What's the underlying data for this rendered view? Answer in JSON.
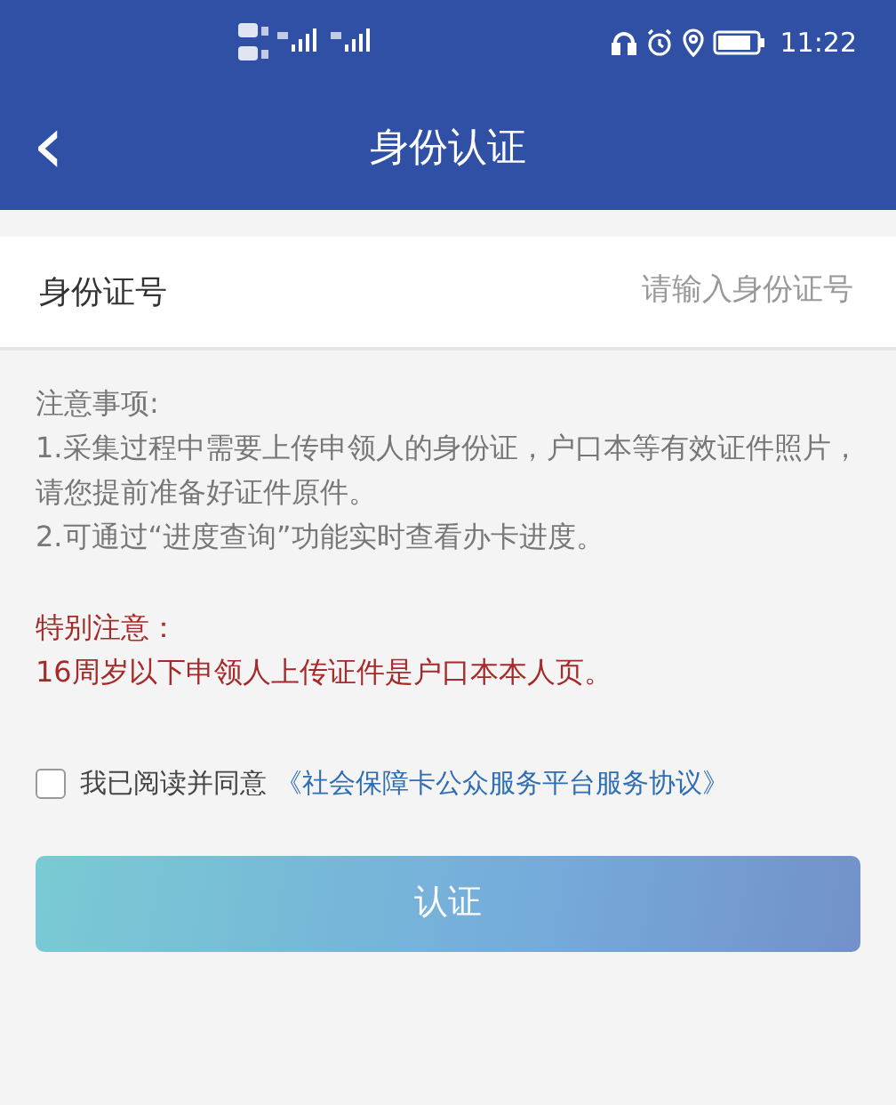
{
  "status_bar": {
    "time": "11:22"
  },
  "header": {
    "back": "‹",
    "title": "身份认证"
  },
  "id_field": {
    "label": "身份证号",
    "placeholder": "请输入身份证号"
  },
  "notes": {
    "heading": "注意事项:",
    "items": [
      "1.采集过程中需要上传申领人的身份证，户口本等有效证件照片，请您提前准备好证件原件。",
      "2.可通过“进度查询”功能实时查看办卡进度。"
    ]
  },
  "warning": {
    "heading": "特别注意：",
    "text": "16周岁以下申领人上传证件是户口本本人页。"
  },
  "agreement": {
    "checked": false,
    "text": "我已阅读并同意",
    "link": "《社会保障卡公众服务平台服务协议》"
  },
  "submit": {
    "label": "认证",
    "disabled": true
  }
}
